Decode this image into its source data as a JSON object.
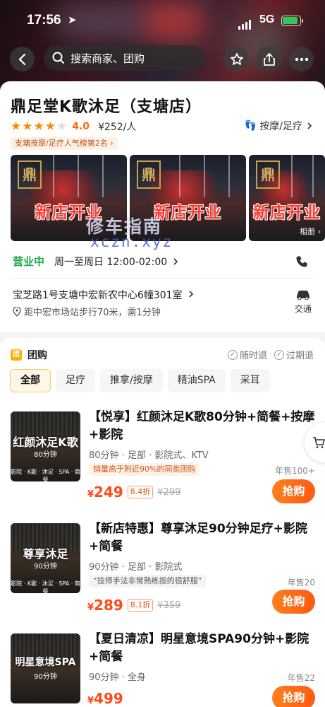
{
  "status_bar": {
    "time": "17:56",
    "network": "5G"
  },
  "top_bar": {
    "search_placeholder": "搜索商家、团购"
  },
  "shop": {
    "name": "鼎足堂K歌沐足（支塘店）",
    "rating": 4.0,
    "rating_text": "4.0",
    "price_per_person": "¥252/人",
    "category": "按摩/足疗",
    "rank_badge": "支塘按摩/足疗人气榜第2名",
    "photos": [
      {
        "logo": "鼎",
        "promo": "新店开业"
      },
      {
        "logo": "鼎",
        "promo": "新店开业"
      },
      {
        "logo": "鼎",
        "promo": "新店开业"
      }
    ],
    "album_label": "相册",
    "watermark_line1": "修车指南",
    "watermark_line2": "xczn.xyz",
    "open_status": "营业中",
    "hours": "周一至周日 12:00-02:00",
    "address": "宝芝路1号支塘中宏新农中心6幢301室",
    "distance": "距中宏市场站步行70米，需1分钟",
    "traffic_label": "交通"
  },
  "group_buy": {
    "icon_text": "团",
    "title": "团购",
    "policy1": "随时退",
    "policy2": "过期退",
    "filters": [
      "全部",
      "足疗",
      "推拿/按摩",
      "精油SPA",
      "采耳"
    ],
    "active_filter": 0,
    "deals": [
      {
        "thumb_title": "红颜沐足K歌",
        "thumb_duration": "80分钟",
        "thumb_tags": "影院 · K歌 · 沐足 · SPA · 简餐",
        "title": "【悦享】红颜沐足K歌80分钟+简餐+按摩+影院",
        "meta": "80分钟 · 足部 · 影院式、KTV",
        "note": "销量高于附近90%的同类团购",
        "sold": "年售100+",
        "price": "249",
        "discount": "8.4折",
        "original": "¥299",
        "buy": "抢购"
      },
      {
        "thumb_title": "尊享沐足",
        "thumb_duration": "90分钟",
        "thumb_tags": "影院 · K歌 · 沐足 · SPA · 简餐",
        "title": "【新店特惠】尊享沐足90分钟足疗+影院+简餐",
        "meta": "90分钟 · 足部 · 影院式",
        "note": "“技师手法非常熟练按的很舒服”",
        "sold": "年售20",
        "price": "289",
        "discount": "8.1折",
        "original": "¥359",
        "buy": "抢购"
      },
      {
        "thumb_title": "明星意境SPA",
        "thumb_duration": "90分钟",
        "thumb_tags": "",
        "title": "【夏日清凉】明星意境SPA90分钟+影院+简餐",
        "meta": "90分钟 · 全身",
        "note": "",
        "sold": "年售22",
        "price": "499",
        "discount": "",
        "original": "",
        "buy": "抢购"
      }
    ]
  },
  "colors": {
    "accent": "#ff5a14",
    "price": "#ff4a1a",
    "open": "#1ea84b",
    "star": "#ff8a00"
  }
}
